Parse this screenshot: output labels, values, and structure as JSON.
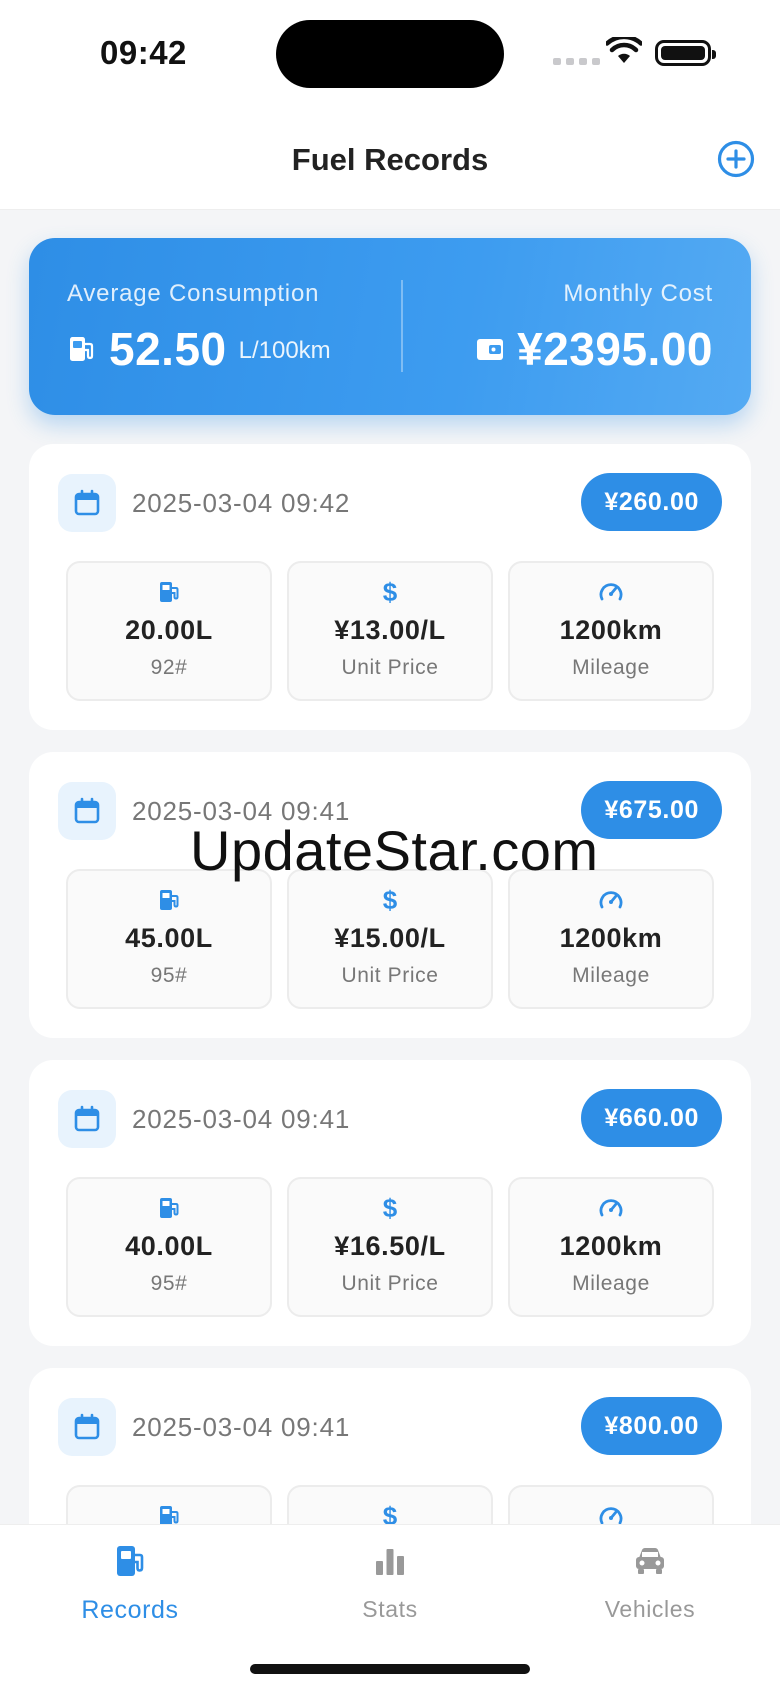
{
  "status_bar": {
    "time": "09:42"
  },
  "nav": {
    "title": "Fuel Records",
    "add_icon": "plus-circle-icon"
  },
  "summary": {
    "avg_label": "Average Consumption",
    "avg_value": "52.50",
    "avg_unit": "L/100km",
    "cost_label": "Monthly Cost",
    "cost_value": "¥2395.00"
  },
  "records": [
    {
      "date": "2025-03-04 09:42",
      "amount": "¥260.00",
      "volume": "20.00L",
      "grade": "92#",
      "unit_price": "¥13.00/L",
      "unit_price_label": "Unit Price",
      "mileage": "1200km",
      "mileage_label": "Mileage"
    },
    {
      "date": "2025-03-04 09:41",
      "amount": "¥675.00",
      "volume": "45.00L",
      "grade": "95#",
      "unit_price": "¥15.00/L",
      "unit_price_label": "Unit Price",
      "mileage": "1200km",
      "mileage_label": "Mileage"
    },
    {
      "date": "2025-03-04 09:41",
      "amount": "¥660.00",
      "volume": "40.00L",
      "grade": "95#",
      "unit_price": "¥16.50/L",
      "unit_price_label": "Unit Price",
      "mileage": "1200km",
      "mileage_label": "Mileage"
    },
    {
      "date": "2025-03-04 09:41",
      "amount": "¥800.00",
      "volume": "",
      "grade": "",
      "unit_price": "",
      "unit_price_label": "",
      "mileage": "",
      "mileage_label": ""
    }
  ],
  "stat_icons": {
    "volume": "fuel-pump-icon",
    "unit_price": "dollar-icon",
    "mileage": "speedometer-icon"
  },
  "watermark": "UpdateStar.com",
  "tabs": [
    {
      "label": "Records",
      "icon": "fuel-pump-icon",
      "active": true
    },
    {
      "label": "Stats",
      "icon": "bar-chart-icon",
      "active": false
    },
    {
      "label": "Vehicles",
      "icon": "car-icon",
      "active": false
    }
  ],
  "colors": {
    "accent": "#2e8ee6",
    "card_bg": "#ffffff",
    "page_bg": "#f4f5f7"
  }
}
